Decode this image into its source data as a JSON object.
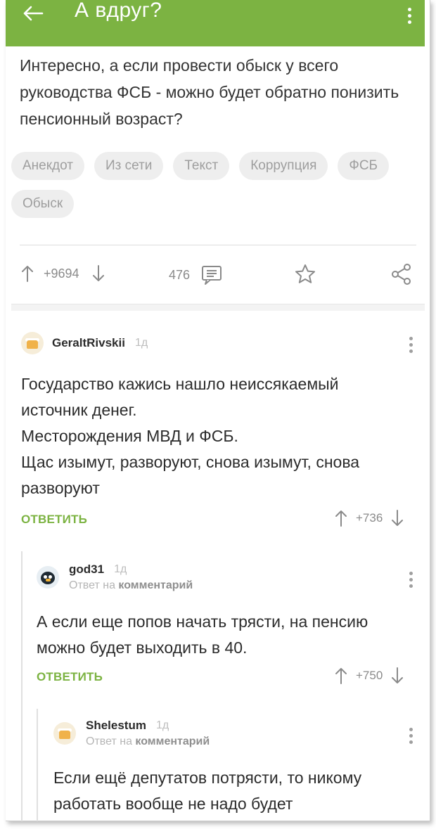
{
  "header": {
    "title": "А вдруг?"
  },
  "post": {
    "text": "Интересно, а если провести обыск у всего руководства ФСБ - можно будет обратно понизить пенсионный возраст?",
    "tags": [
      "Анекдот",
      "Из сети",
      "Текст",
      "Коррупция",
      "ФСБ",
      "Обыск"
    ],
    "rating": "+9694",
    "comments_count": "476"
  },
  "comments": [
    {
      "user": "GeraltRivskii",
      "time": "1д",
      "text_lines": [
        "Государство кажись нашло неиссякаемый",
        "источник денег.",
        "Месторождения МВД и ФСБ.",
        "Щас изымут, разворуют, снова изымут, снова",
        "разворуют"
      ],
      "reply_label": "ОТВЕТИТЬ",
      "rating": "+736"
    },
    {
      "user": "god31",
      "time": "1д",
      "reply_prefix": "Ответ на",
      "reply_target": "комментарий",
      "text_lines": [
        "А если еще попов начать трясти, на пенсию",
        "можно будет выходить в 40."
      ],
      "reply_label": "ОТВЕТИТЬ",
      "rating": "+750"
    },
    {
      "user": "Shelestum",
      "time": "1д",
      "reply_prefix": "Ответ на",
      "reply_target": "комментарий",
      "text_lines": [
        "Если ещё депутатов потрясти, то никому",
        "работать вообще не надо будет"
      ]
    }
  ],
  "colors": {
    "accent": "#7cb342",
    "text": "#2c2c2c",
    "muted": "#9e9e9e"
  },
  "icons": [
    "back-arrow-icon",
    "more-vert-icon",
    "upvote-icon",
    "downvote-icon",
    "comments-icon",
    "star-icon",
    "share-icon"
  ]
}
